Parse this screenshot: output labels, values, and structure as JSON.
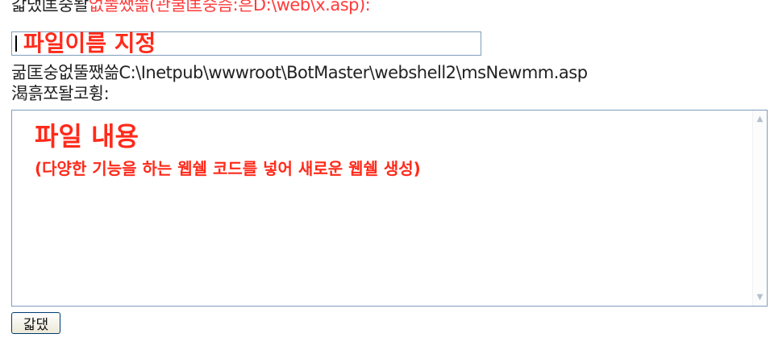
{
  "save_path_row": {
    "label": "갋댔匡숭돨",
    "value": "없뚤쨌쓺(관쿨匡숭츰:흔D:\\web\\x.asp):"
  },
  "filename_input": {
    "value": "",
    "overlay_annotation": "파일이름 지정"
  },
  "current_path_row": {
    "label": "굶匡숭없뚤쨌쓺",
    "value": "C:\\Inetpub\\wwwroot\\BotMaster\\webshell2\\msNewmm.asp"
  },
  "content_label": "渴흙쪼돨코휭:",
  "content_textarea": {
    "annotation_title": "파일 내용",
    "annotation_desc": "(다양한 기능을 하는 웹쉘 코드를 넣어 새로운 웹쉘 생성)"
  },
  "submit_button": {
    "label": "갋댔"
  },
  "colors": {
    "annotation": "#ff2a1a",
    "path_value": "#ff3b3b",
    "field_border": "#7f9db9"
  }
}
